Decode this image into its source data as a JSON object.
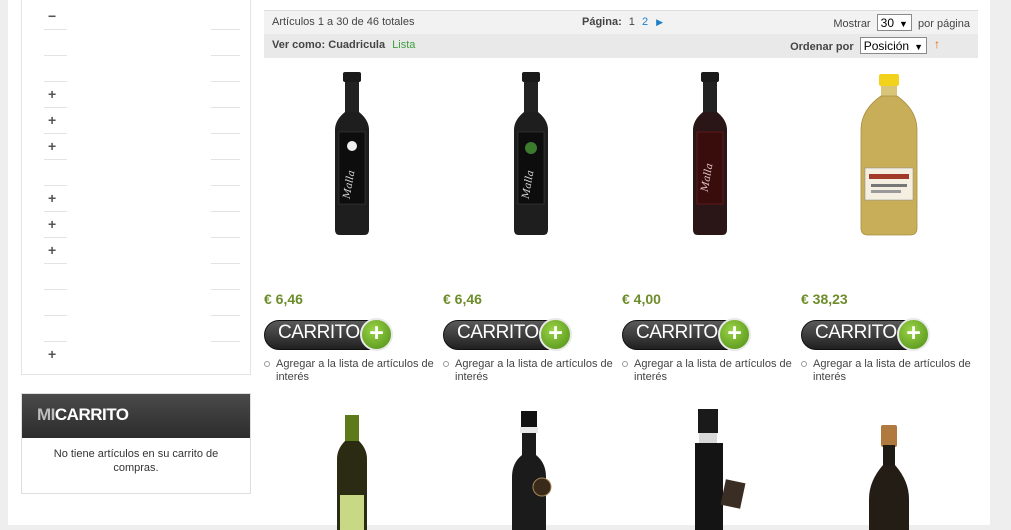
{
  "sidebar": {
    "category_toggles": [
      "−",
      "",
      "",
      "+",
      "+",
      "+",
      "",
      "+",
      "+",
      "+",
      "",
      "",
      "",
      "+"
    ]
  },
  "cart": {
    "title_mi": "MI",
    "title_rest": "CARRITO",
    "empty_text": "No tiene artículos en su carrito de compras."
  },
  "toolbar": {
    "count_text": "Artículos 1 a 30 de 46 totales",
    "page_label": "Página:",
    "current_page": "1",
    "page_2": "2",
    "next": "▶",
    "show_label": "Mostrar",
    "per_page_value": "30",
    "per_page_suffix": "por página",
    "view_label": "Ver como:",
    "view_grid": "Cuadricula",
    "view_list": "Lista",
    "sort_label": "Ordenar por",
    "sort_value": "Posición",
    "sort_direction": "↑"
  },
  "products": [
    {
      "price": "€ 6,46",
      "cart_label": "CARRITO",
      "wishlist": "Agregar a la lista de artículos de interés",
      "bottle": "dark-white-label"
    },
    {
      "price": "€ 6,46",
      "cart_label": "CARRITO",
      "wishlist": "Agregar a la lista de artículos de interés",
      "bottle": "dark-green-label"
    },
    {
      "price": "€ 4,00",
      "cart_label": "CARRITO",
      "wishlist": "Agregar a la lista de artículos de interés",
      "bottle": "dark-red-label"
    },
    {
      "price": "€ 38,23",
      "cart_label": "CARRITO",
      "wishlist": "Agregar a la lista de artículos de interés",
      "bottle": "plastic-jug"
    }
  ],
  "colors": {
    "price": "#6d8c2a",
    "list_link": "#3f9e3f",
    "page_link": "#1e7ec8",
    "sort_arrow": "#e26703",
    "plus_green": "#6cb02a"
  }
}
